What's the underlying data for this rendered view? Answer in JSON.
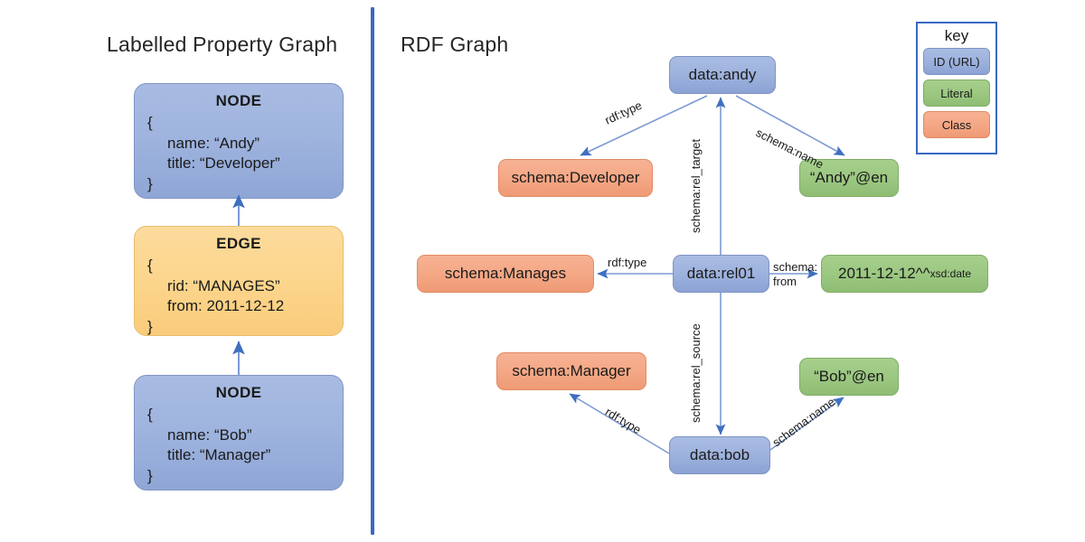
{
  "panels": {
    "left_title": "Labelled Property Graph",
    "right_title": "RDF Graph"
  },
  "lpg": {
    "boxes": [
      {
        "title": "NODE",
        "open_brace": "{",
        "props": [
          "name: “Andy”",
          "title: “Developer”"
        ],
        "close_brace": "}",
        "kind": "node"
      },
      {
        "title": "EDGE",
        "open_brace": "{",
        "props": [
          "rid: “MANAGES”",
          "from: 2011-12-12"
        ],
        "close_brace": "}",
        "kind": "edge"
      },
      {
        "title": "NODE",
        "open_brace": "{",
        "props": [
          "name: “Bob”",
          "title: “Manager”"
        ],
        "close_brace": "}",
        "kind": "node"
      }
    ]
  },
  "rdf": {
    "nodes": [
      {
        "id": "data-andy",
        "label": "data:andy",
        "kind": "id"
      },
      {
        "id": "schema-developer",
        "label": "schema:Developer",
        "kind": "class"
      },
      {
        "id": "andy-literal",
        "label": "“Andy”@en",
        "kind": "literal"
      },
      {
        "id": "schema-manages",
        "label": "schema:Manages",
        "kind": "class"
      },
      {
        "id": "data-rel01",
        "label": "data:rel01",
        "kind": "id"
      },
      {
        "id": "date-literal",
        "label": "2011-12-12^^",
        "label_suffix": "xsd:date",
        "kind": "literal"
      },
      {
        "id": "schema-manager",
        "label": "schema:Manager",
        "kind": "class"
      },
      {
        "id": "bob-literal",
        "label": "“Bob”@en",
        "kind": "literal"
      },
      {
        "id": "data-bob",
        "label": "data:bob",
        "kind": "id"
      }
    ],
    "edges": [
      {
        "id": "andy-rdftype",
        "label": "rdf:type",
        "from": "data:andy",
        "to": "schema:Developer"
      },
      {
        "id": "andy-name",
        "label": "schema:name",
        "from": "data:andy",
        "to": "“Andy”@en"
      },
      {
        "id": "rel-target",
        "label": "schema:rel_target",
        "from": "data:rel01",
        "to": "data:andy"
      },
      {
        "id": "rel-rdftype",
        "label": "rdf:type",
        "from": "data:rel01",
        "to": "schema:Manages"
      },
      {
        "id": "rel-from",
        "label": "schema:",
        "label2": "from",
        "from": "data:rel01",
        "to": "2011-12-12^^xsd:date"
      },
      {
        "id": "rel-source",
        "label": "schema:rel_source",
        "from": "data:rel01",
        "to": "data:bob"
      },
      {
        "id": "bob-rdftype",
        "label": "rdf:type",
        "from": "data:bob",
        "to": "schema:Manager"
      },
      {
        "id": "bob-name",
        "label": "schema:name",
        "from": "data:bob",
        "to": "“Bob”@en"
      }
    ]
  },
  "key": {
    "title": "key",
    "items": [
      {
        "label": "ID (URL)",
        "kind": "id",
        "color": "#9db2dd"
      },
      {
        "label": "Literal",
        "kind": "literal",
        "color": "#9cc882"
      },
      {
        "label": "Class",
        "kind": "class",
        "color": "#f4a886"
      }
    ]
  },
  "colors": {
    "divider": "#3A67C4",
    "id_blue": "#9db2dd",
    "literal_green": "#9cc882",
    "class_orange": "#f4a886",
    "edge_yellow": "#fcd68e",
    "arrow": "#5b84c8"
  }
}
